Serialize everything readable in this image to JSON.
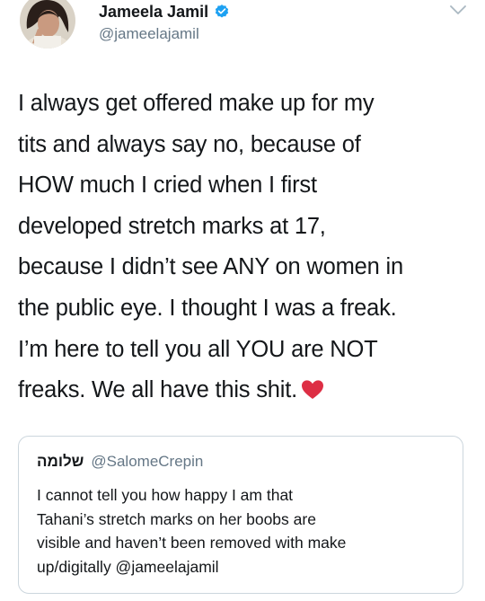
{
  "tweet": {
    "author": {
      "display_name": "Jameela Jamil",
      "handle": "@jameelajamil",
      "verified": true,
      "avatar": "profile-photo"
    },
    "menu_icon": "chevron-down-icon",
    "text_lines": [
      "I always get offered make up for my",
      "tits and always say no, because of",
      "HOW much I cried when I first",
      "developed stretch marks at 17,",
      "because I didn’t see ANY on women in",
      "the public eye. I thought I was a freak.",
      "I’m here to tell you all YOU are NOT",
      "freaks. We all have this shit."
    ],
    "trailing_emoji": "heart-icon",
    "accent_color": "#1da1f2",
    "heart_color": "#dd2e44"
  },
  "quoted_tweet": {
    "display_name": "שלומה",
    "handle": "@SalomeCrepin",
    "text_lines": [
      "I cannot tell you how happy I am that",
      "Tahani’s stretch marks on her boobs are",
      "visible and haven’t been removed with make",
      "up/digitally @jameelajamil"
    ]
  }
}
